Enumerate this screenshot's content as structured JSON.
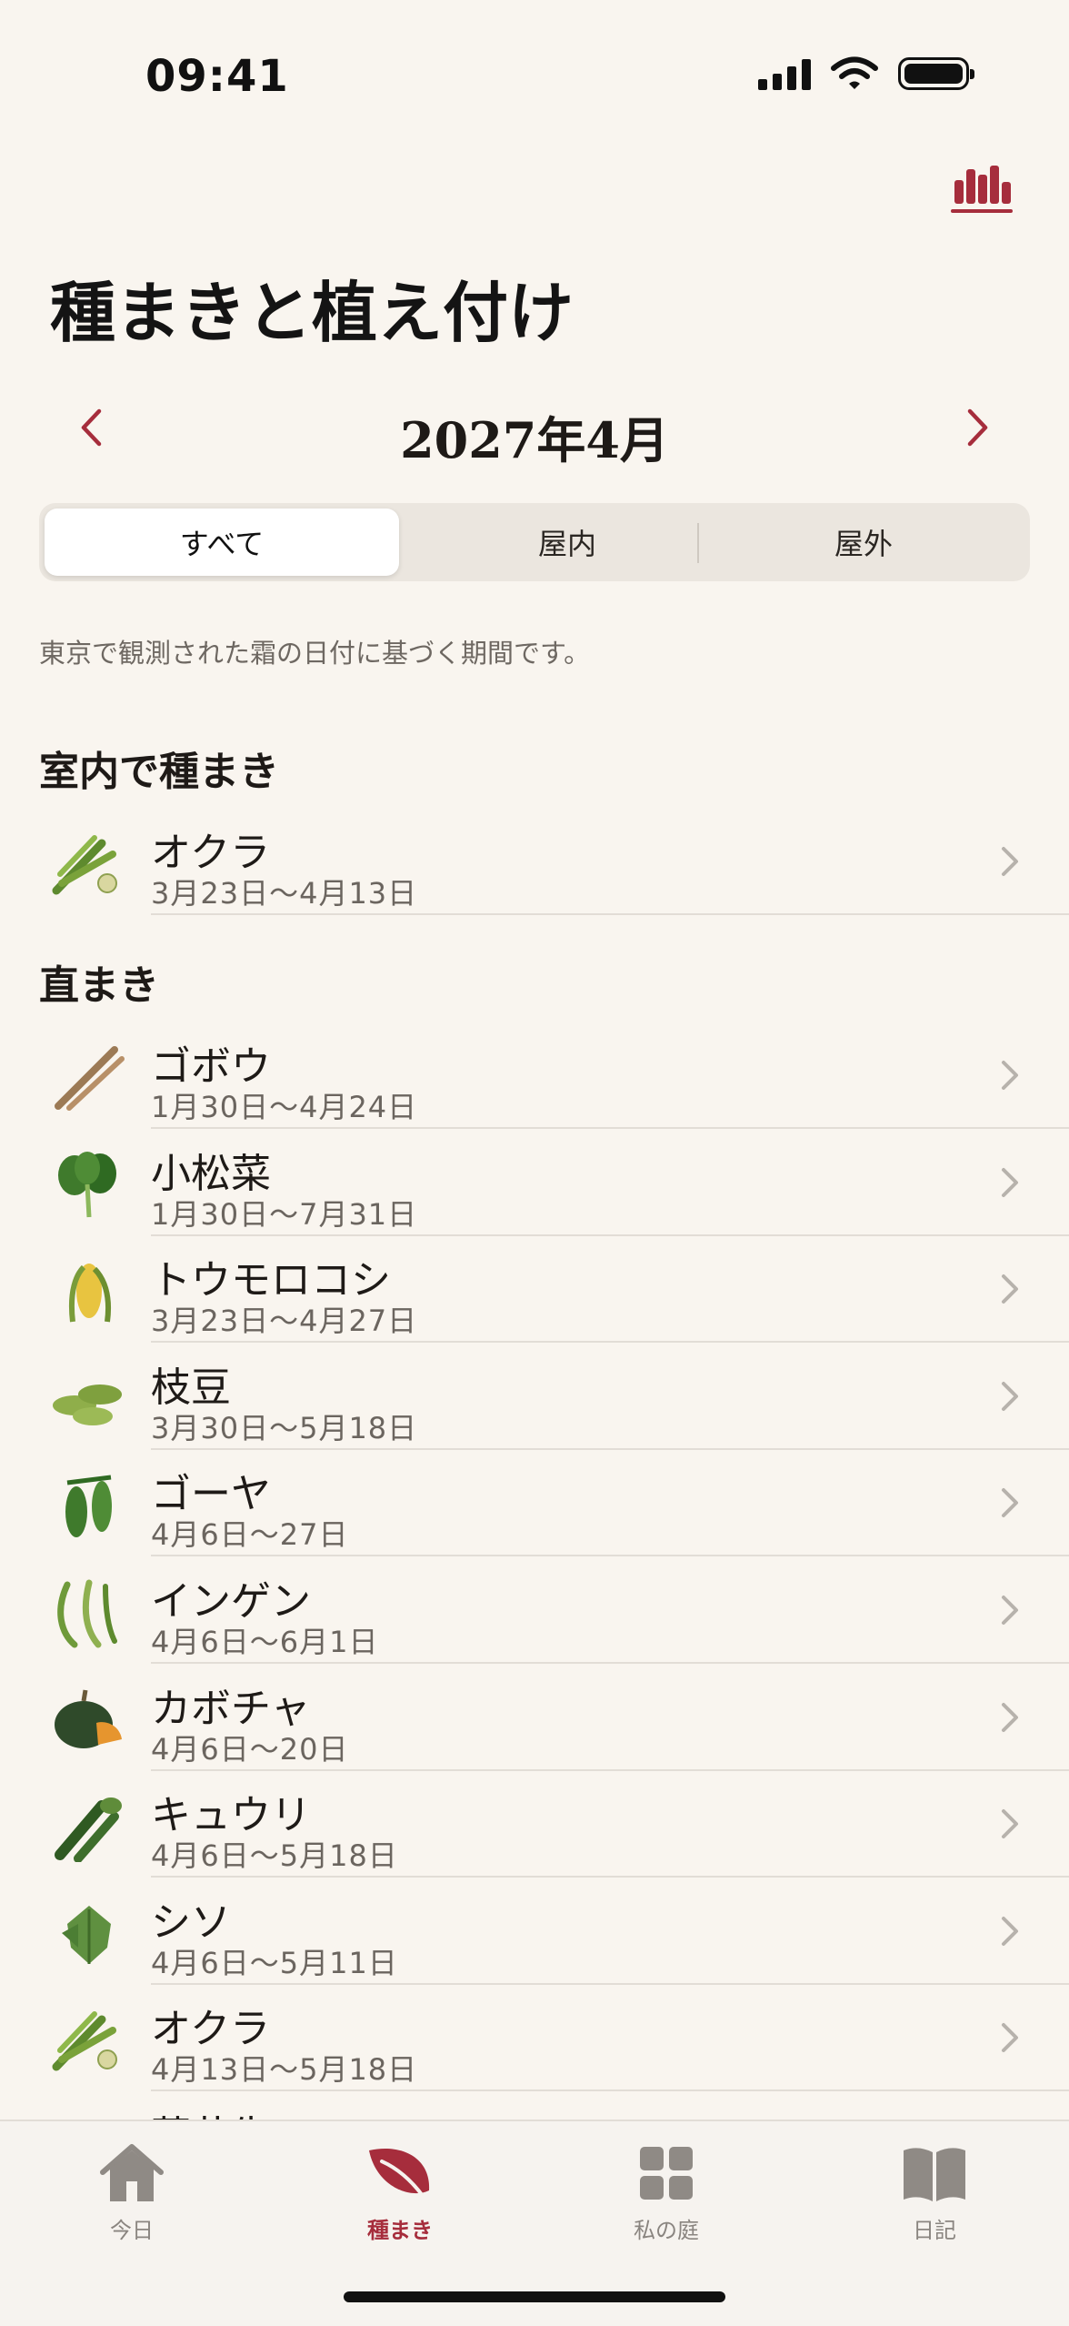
{
  "status": {
    "time": "09:41"
  },
  "header": {
    "title": "種まきと植え付け",
    "stats_icon": "bar-chart-icon"
  },
  "month_nav": {
    "label": "2027年4月",
    "prev_icon": "chevron-left-icon",
    "next_icon": "chevron-right-icon"
  },
  "filter": {
    "selected": "すべて",
    "options": [
      "すべて",
      "屋内",
      "屋外"
    ]
  },
  "caption": "東京で観測された霜の日付に基づく期間です。",
  "sections": [
    {
      "title": "室内で種まき",
      "items": [
        {
          "name": "オクラ",
          "dates": "3月23日～4月13日",
          "icon": "okra"
        }
      ]
    },
    {
      "title": "直まき",
      "items": [
        {
          "name": "ゴボウ",
          "dates": "1月30日～4月24日",
          "icon": "burdock"
        },
        {
          "name": "小松菜",
          "dates": "1月30日～7月31日",
          "icon": "komatsuna"
        },
        {
          "name": "トウモロコシ",
          "dates": "3月23日～4月27日",
          "icon": "corn"
        },
        {
          "name": "枝豆",
          "dates": "3月30日～5月18日",
          "icon": "edamame"
        },
        {
          "name": "ゴーヤ",
          "dates": "4月6日～27日",
          "icon": "bitter-melon"
        },
        {
          "name": "インゲン",
          "dates": "4月6日～6月1日",
          "icon": "green-bean"
        },
        {
          "name": "カボチャ",
          "dates": "4月6日～20日",
          "icon": "pumpkin"
        },
        {
          "name": "キュウリ",
          "dates": "4月6日～5月18日",
          "icon": "cucumber"
        },
        {
          "name": "シソ",
          "dates": "4月6日～5月11日",
          "icon": "shiso"
        },
        {
          "name": "オクラ",
          "dates": "4月13日～5月18日",
          "icon": "okra"
        },
        {
          "name": "落花生",
          "dates": "",
          "icon": "peanut"
        }
      ]
    }
  ],
  "tabs": [
    {
      "label": "今日",
      "icon": "house-icon",
      "active": false
    },
    {
      "label": "種まき",
      "icon": "leaf-icon",
      "active": true
    },
    {
      "label": "私の庭",
      "icon": "grid-icon",
      "active": false
    },
    {
      "label": "日記",
      "icon": "book-icon",
      "active": false
    }
  ],
  "colors": {
    "accent": "#a62d3c",
    "background": "#f9f5ef",
    "text": "#1e1a17",
    "secondary": "#6b655f"
  }
}
